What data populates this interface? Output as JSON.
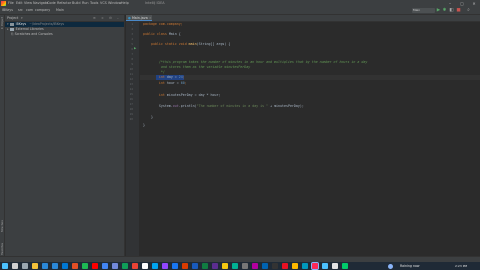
{
  "menubar": {
    "items": [
      "File",
      "Edit",
      "View",
      "Navigate",
      "Code",
      "Refactor",
      "Build",
      "Run",
      "Tools",
      "VCS",
      "Window",
      "Help"
    ],
    "window_title": "IntelliJ IDEA"
  },
  "navbar": {
    "crumbs": [
      "IBKeys",
      "src",
      "com",
      "company",
      "Main"
    ],
    "run_config": "Main",
    "branch": ""
  },
  "sidebar": {
    "vertical_labels": [
      "1: Project",
      "Structure",
      "Favorites"
    ]
  },
  "project_panel": {
    "title": "Project",
    "tree": [
      {
        "label": "IBKeys",
        "path": "~/IdeaProjects/IBKeys",
        "selected": true
      },
      {
        "label": "External Libraries",
        "path": "",
        "selected": false
      },
      {
        "label": "Scratches and Consoles",
        "path": "",
        "selected": false
      }
    ]
  },
  "editor": {
    "tab": "Main.java",
    "line_numbers": [
      "1",
      "2",
      "3",
      "4",
      "5",
      "6",
      "7",
      "8",
      "9",
      "10",
      "11",
      "12",
      "13",
      "14",
      "15",
      "16",
      "17",
      "18",
      "19",
      "20"
    ],
    "lines": {
      "l1": "package com.company;",
      "l3_kw": "public class ",
      "l3_name": "Main {",
      "l5_kw": "public static void ",
      "l5_fn": "main",
      "l5_rest": "(String[] args) {",
      "l7": "/*this program takes the number of minutes in an hour and multiplies that by the number of hours in a day",
      "l8": " and stores them as the variable minutesPerDay",
      "l9": " */",
      "l10_kw": "int ",
      "l10_rest": "day = ",
      "l10_num": "24",
      "l10_end": ";",
      "l11_kw": "int ",
      "l11_rest": "hour = ",
      "l11_num": "60",
      "l11_end": ";",
      "l13_kw": "int ",
      "l13_rest": "minutesPerDay = day * hour;",
      "l15_a": "System.",
      "l15_b": "out",
      "l15_c": ".println(",
      "l15_d": "\"The number of minutes in a day is \"",
      "l15_e": " + minutesPerDay);",
      "l17": "}",
      "l18": "}"
    }
  },
  "taskbar": {
    "status_text": "Raining now",
    "time": "2:23 PM",
    "date": "1/1/2021"
  }
}
